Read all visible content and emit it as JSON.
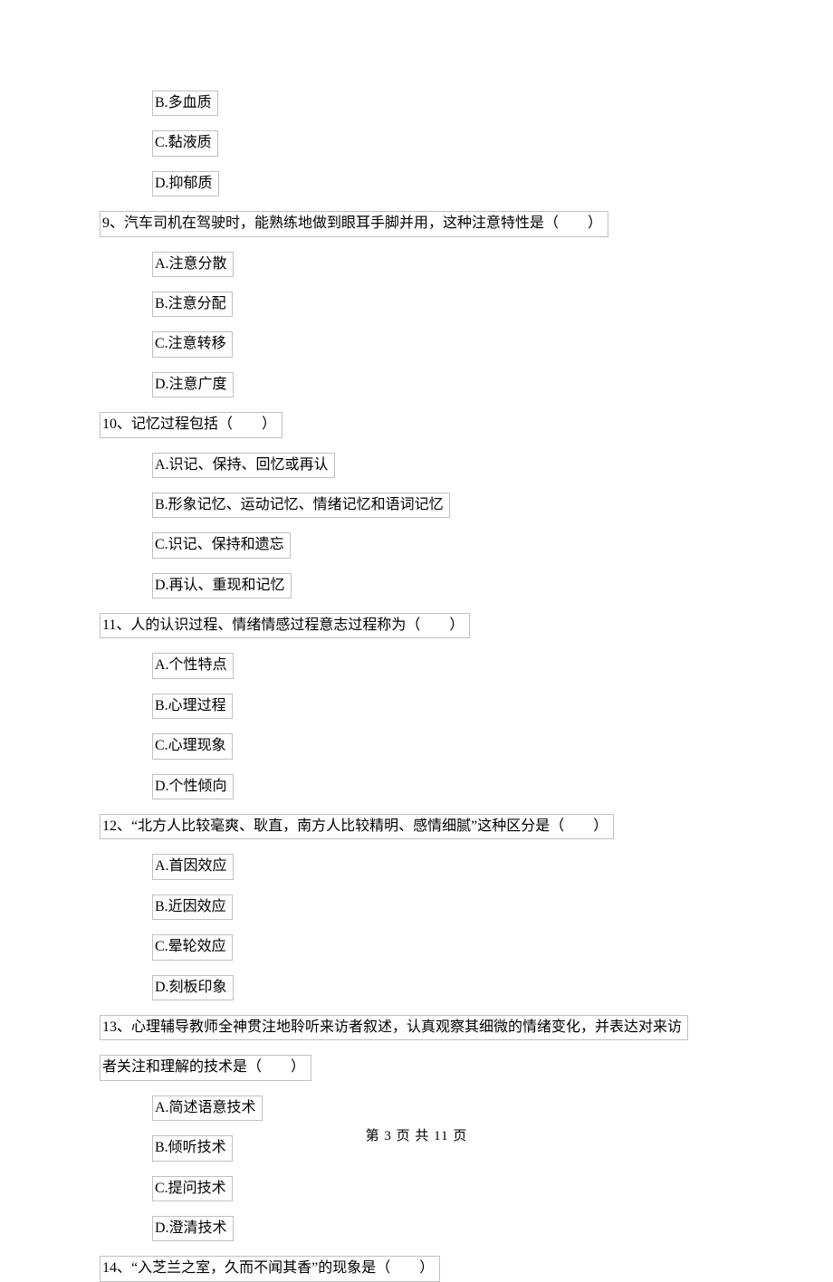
{
  "orphan_options": {
    "B": "B.多血质",
    "C": "C.黏液质",
    "D": "D.抑郁质"
  },
  "questions": [
    {
      "num": "9",
      "text": "9、汽车司机在驾驶时，能熟练地做到眼耳手脚并用，这种注意特性是（　　）",
      "opts": {
        "A": "A.注意分散",
        "B": "B.注意分配",
        "C": "C.注意转移",
        "D": "D.注意广度"
      }
    },
    {
      "num": "10",
      "text": "10、记忆过程包括（　　）",
      "opts": {
        "A": "A.识记、保持、回忆或再认  ",
        "B": "B.形象记忆、运动记忆、情绪记忆和语词记忆",
        "C": "C.识记、保持和遗忘",
        "D": "D.再认、重现和记忆"
      }
    },
    {
      "num": "11",
      "text": "11、人的认识过程、情绪情感过程意志过程称为（　　）",
      "opts": {
        "A": "A.个性特点",
        "B": "B.心理过程",
        "C": "C.心理现象",
        "D": "D.个性倾向"
      }
    },
    {
      "num": "12",
      "text": "12、“北方人比较毫爽、耿直，南方人比较精明、感情细腻”这种区分是（　　）",
      "opts": {
        "A": "A.首因效应",
        "B": "B.近因效应  ",
        "C": "C.晕轮效应",
        "D": "D.刻板印象"
      }
    },
    {
      "num": "13",
      "text_line1": "13、心理辅导教师全神贯注地聆听来访者叙述，认真观察其细微的情绪变化，并表达对来访",
      "text_line2": "者关注和理解的技术是（　　）",
      "opts": {
        "A": "A.简述语意技术",
        "B": "B.倾听技术",
        "C": "C.提问技术",
        "D": "D.澄清技术"
      }
    },
    {
      "num": "14",
      "text": "14、“入芝兰之室，久而不闻其香”的现象是（　　）"
    }
  ],
  "footer": "第 3 页 共 11 页"
}
